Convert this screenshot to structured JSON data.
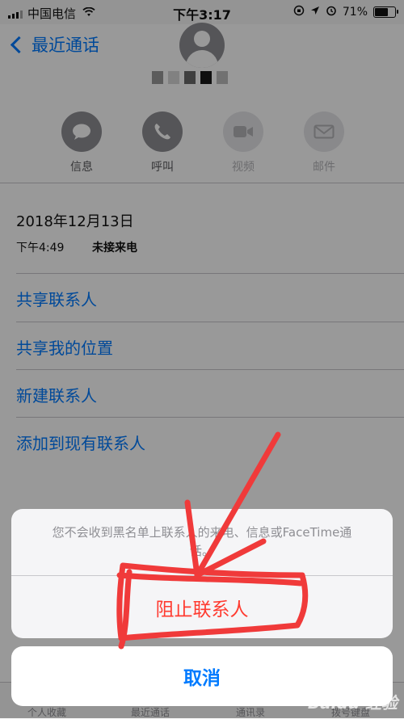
{
  "status_bar": {
    "carrier": "中国电信",
    "time": "下午3:17",
    "battery": "71%",
    "battery_level": 0.71
  },
  "header": {
    "back_label": "最近通话"
  },
  "actions": [
    {
      "label": "信息",
      "icon": "message-icon",
      "enabled": true
    },
    {
      "label": "呼叫",
      "icon": "phone-icon",
      "enabled": true
    },
    {
      "label": "视频",
      "icon": "video-icon",
      "enabled": false
    },
    {
      "label": "邮件",
      "icon": "mail-icon",
      "enabled": false
    }
  ],
  "call_log": {
    "date": "2018年12月13日",
    "time": "下午4:49",
    "status": "未接来电"
  },
  "menu": [
    {
      "label": "共享联系人"
    },
    {
      "label": "共享我的位置"
    },
    {
      "label": "新建联系人"
    },
    {
      "label": "添加到现有联系人"
    }
  ],
  "tabbar": [
    "个人收藏",
    "最近通话",
    "通讯录",
    "拨号键盘"
  ],
  "sheet": {
    "message": "您不会收到黑名单上联系人的来电、信息或FaceTime通话。",
    "block_label": "阻止联系人",
    "cancel_label": "取消"
  },
  "watermark": "Baidu 经验",
  "colors": {
    "ios_blue": "#007aff",
    "destructive_red": "#ff3b30",
    "annotation_red": "#f03a3a"
  }
}
